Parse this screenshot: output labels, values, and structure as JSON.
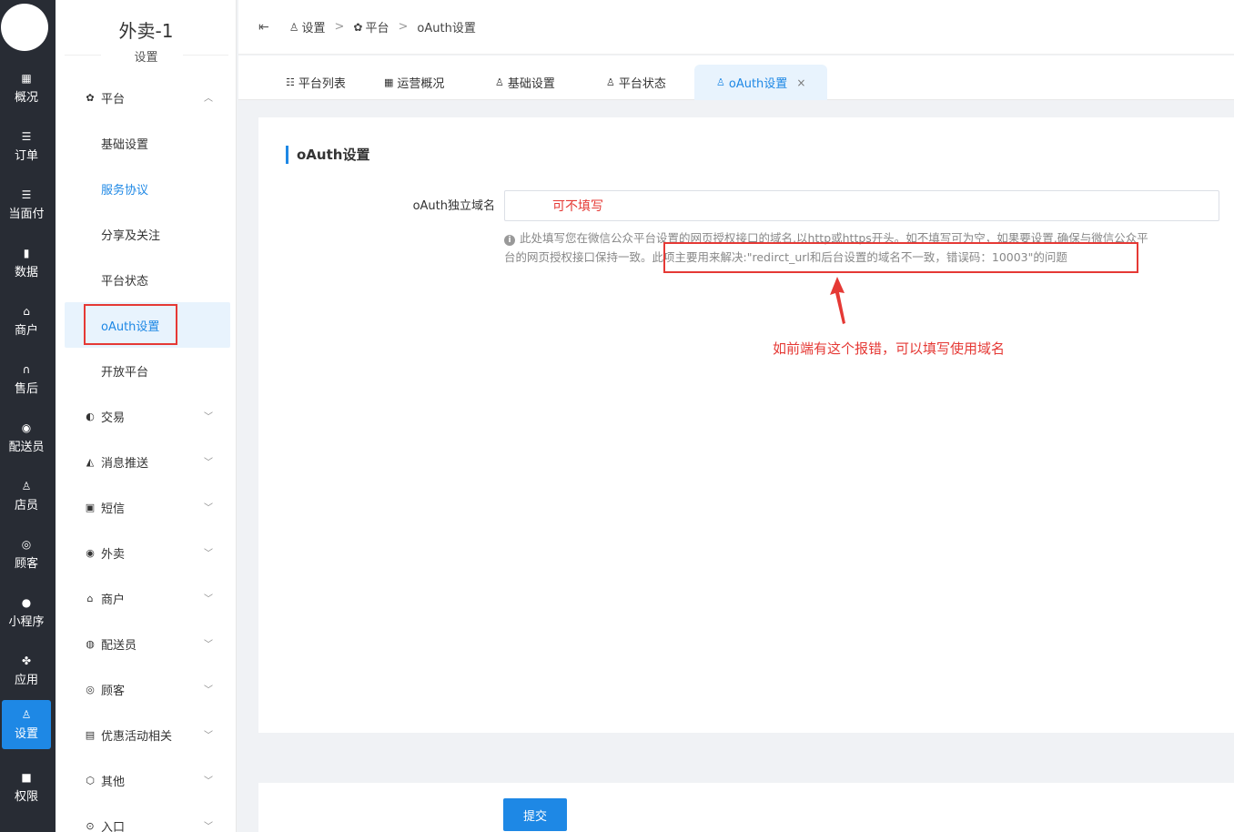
{
  "rail": {
    "items": [
      {
        "label": "概况",
        "icon": "grid-icon"
      },
      {
        "label": "订单",
        "icon": "list-icon"
      },
      {
        "label": "当面付",
        "icon": "list-icon"
      },
      {
        "label": "数据",
        "icon": "bar-chart-icon"
      },
      {
        "label": "商户",
        "icon": "store-icon"
      },
      {
        "label": "售后",
        "icon": "headset-icon"
      },
      {
        "label": "配送员",
        "icon": "scooter-icon"
      },
      {
        "label": "店员",
        "icon": "users-icon"
      },
      {
        "label": "顾客",
        "icon": "user-circle-icon"
      },
      {
        "label": "小程序",
        "icon": "wechat-icon"
      },
      {
        "label": "应用",
        "icon": "apps-icon"
      },
      {
        "label": "设置",
        "icon": "user-settings-icon"
      },
      {
        "label": "权限",
        "icon": "lock-icon"
      }
    ],
    "active_index": 11
  },
  "sidebar": {
    "shop_name": "外卖-1",
    "section_title": "设置",
    "groups": [
      {
        "label": "平台",
        "icon": "gear-icon",
        "expanded": true
      },
      {
        "label": "交易",
        "icon": "wallet-icon"
      },
      {
        "label": "消息推送",
        "icon": "send-icon"
      },
      {
        "label": "短信",
        "icon": "chat-icon"
      },
      {
        "label": "外卖",
        "icon": "scooter-icon"
      },
      {
        "label": "商户",
        "icon": "store-icon"
      },
      {
        "label": "配送员",
        "icon": "courier-icon"
      },
      {
        "label": "顾客",
        "icon": "user-circle-icon"
      },
      {
        "label": "优惠活动相关",
        "icon": "gift-icon"
      },
      {
        "label": "其他",
        "icon": "hexagon-icon"
      },
      {
        "label": "入口",
        "icon": "compass-icon"
      }
    ],
    "platform_items": [
      {
        "label": "基础设置"
      },
      {
        "label": "服务协议"
      },
      {
        "label": "分享及关注"
      },
      {
        "label": "平台状态"
      },
      {
        "label": "oAuth设置"
      },
      {
        "label": "开放平台"
      }
    ]
  },
  "header": {
    "breadcrumb": [
      "设置",
      "平台",
      "oAuth设置"
    ]
  },
  "tabs": [
    {
      "label": "平台列表",
      "icon": "list-icon"
    },
    {
      "label": "运营概况",
      "icon": "grid-icon"
    },
    {
      "label": "基础设置",
      "icon": "user-settings-icon"
    },
    {
      "label": "平台状态",
      "icon": "user-settings-icon"
    },
    {
      "label": "oAuth设置",
      "icon": "user-settings-icon",
      "active": true,
      "close": "×"
    }
  ],
  "form": {
    "title": "oAuth设置",
    "field_label": "oAuth独立域名",
    "field_value": "可不填写",
    "help_line1": "此处填写您在微信公众平台设置的网页授权接口的域名,以http或https开头。如不填写可为空，如果要设置,确保与微信公众平",
    "help_line2_a": "台的网页授权接口保持一致。",
    "help_line2_b": "此项主要用来解决:\"redirct_url和后台设置的域名不一致，错误码：10003\"的问题",
    "annotation": "如前端有这个报错，可以填写使用域名",
    "submit_label": "提交"
  },
  "colors": {
    "primary": "#1e88e5",
    "rail_bg": "#282c34",
    "annotation_red": "#e53935"
  }
}
